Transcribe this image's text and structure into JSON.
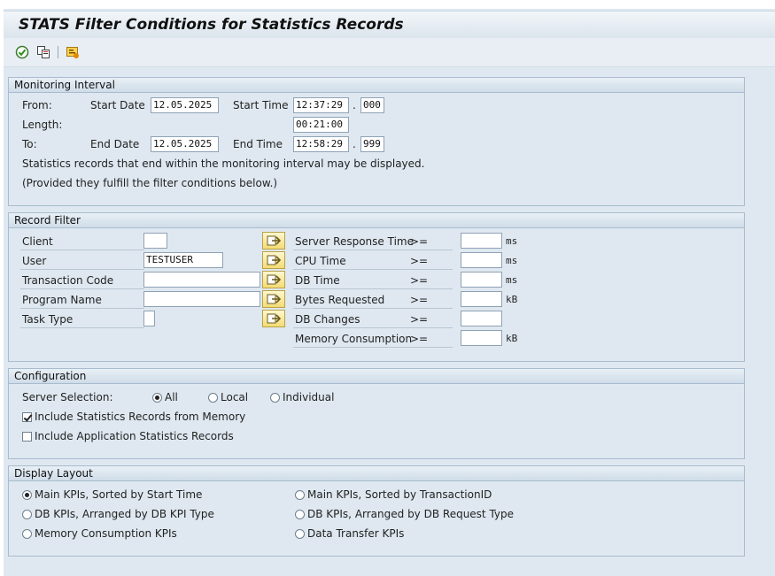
{
  "title": "STATS Filter Conditions for Statistics Records",
  "toolbar": {
    "icons": [
      "execute-icon",
      "copy-icon",
      "info-icon"
    ]
  },
  "monitoring": {
    "header": "Monitoring Interval",
    "from_label": "From:",
    "start_date_label": "Start Date",
    "start_date": "12.05.2025",
    "start_time_label": "Start Time",
    "start_time": "12:37:29",
    "start_ms": "000",
    "length_label": "Length:",
    "length": "00:21:00",
    "to_label": "To:",
    "end_date_label": "End Date",
    "end_date": "12.05.2025",
    "end_time_label": "End Time",
    "end_time": "12:58:29",
    "end_ms": "999",
    "dot": ".",
    "note1": "Statistics records that end within the monitoring interval may be displayed.",
    "note2": "(Provided they fulfill the filter conditions below.)"
  },
  "record_filter": {
    "header": "Record Filter",
    "left": [
      {
        "label": "Client",
        "value": ""
      },
      {
        "label": "User",
        "value": "TESTUSER"
      },
      {
        "label": "Transaction Code",
        "value": ""
      },
      {
        "label": "Program Name",
        "value": ""
      },
      {
        "label": "Task Type",
        "value": ""
      }
    ],
    "right": [
      {
        "label": "Server Response Time",
        "op": ">=",
        "value": "",
        "unit": "ms"
      },
      {
        "label": "CPU Time",
        "op": ">=",
        "value": "",
        "unit": "ms"
      },
      {
        "label": "DB Time",
        "op": ">=",
        "value": "",
        "unit": "ms"
      },
      {
        "label": "Bytes Requested",
        "op": ">=",
        "value": "",
        "unit": "kB"
      },
      {
        "label": "DB Changes",
        "op": ">=",
        "value": "",
        "unit": ""
      },
      {
        "label": "Memory Consumption",
        "op": ">=",
        "value": "",
        "unit": "kB"
      }
    ]
  },
  "configuration": {
    "header": "Configuration",
    "server_selection_label": "Server Selection:",
    "options": [
      "All",
      "Local",
      "Individual"
    ],
    "selected": "All",
    "include_memory": "Include Statistics Records from Memory",
    "include_memory_checked": true,
    "include_app": "Include Application Statistics Records",
    "include_app_checked": false
  },
  "display_layout": {
    "header": "Display Layout",
    "options": [
      "Main KPIs, Sorted by Start Time",
      "Main KPIs, Sorted by TransactionID",
      "DB KPIs, Arranged by DB KPI Type",
      "DB KPIs, Arranged by DB Request Type",
      "Memory Consumption KPIs",
      "Data Transfer KPIs"
    ],
    "selected_index": 0
  }
}
